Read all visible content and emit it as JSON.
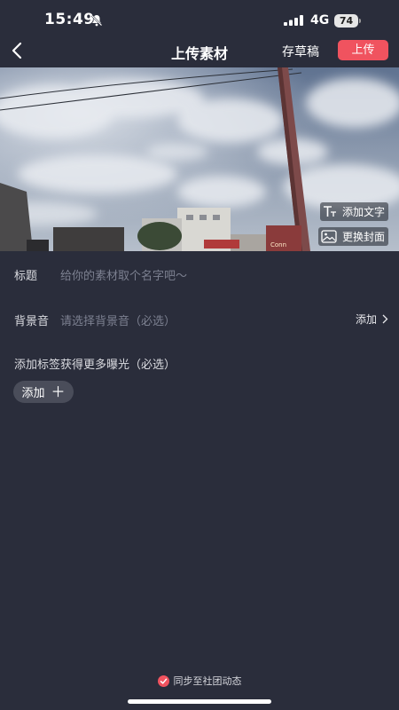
{
  "status_bar": {
    "time": "15:49",
    "network": "4G",
    "battery": "74",
    "icons": [
      "silent-bell-icon",
      "signal-icon"
    ]
  },
  "nav": {
    "title": "上传素材",
    "draft_label": "存草稿",
    "upload_label": "上传",
    "back_icon": "chevron-left-icon"
  },
  "media": {
    "add_text_label": "添加文字",
    "change_cover_label": "更换封面",
    "sign_text": "Conn"
  },
  "form": {
    "title_label": "标题",
    "title_placeholder": "给你的素材取个名字吧～",
    "bgm_label": "背景音",
    "bgm_placeholder": "请选择背景音（必选）",
    "bgm_add_label": "添加",
    "tags_hint": "添加标签获得更多曝光（必选）",
    "tag_add_label": "添加",
    "tag_add_plus": "＋"
  },
  "sync": {
    "label": "同步至社团动态",
    "checked": true
  },
  "colors": {
    "background": "#2a2d3b",
    "accent": "#f0535f",
    "chip": "#4a4d5a"
  }
}
